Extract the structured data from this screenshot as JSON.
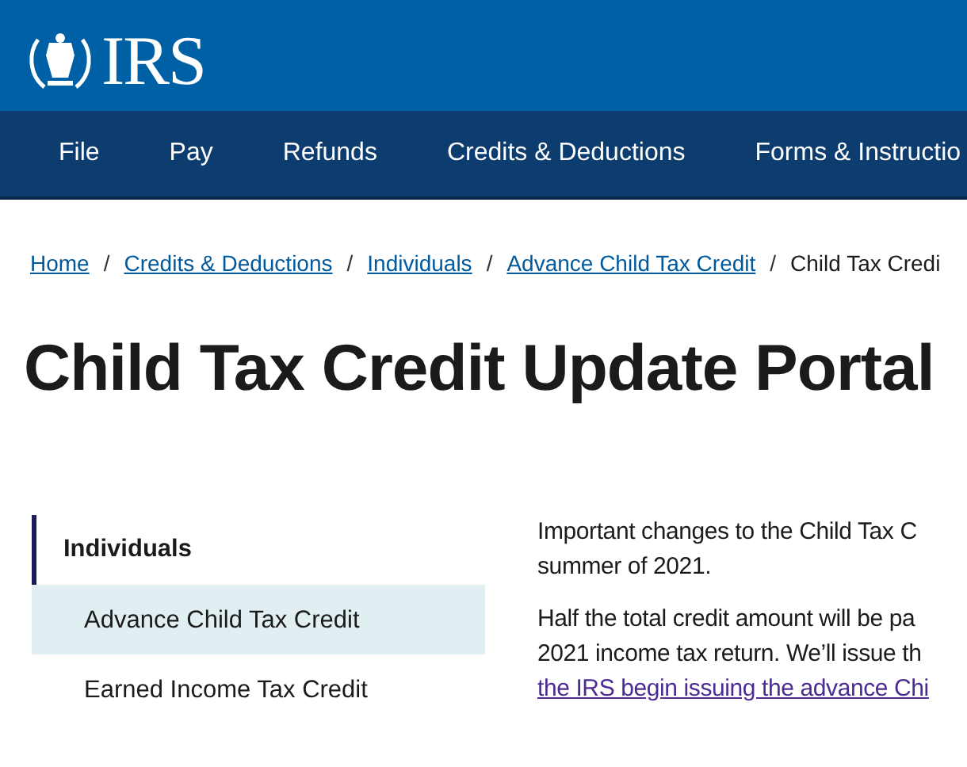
{
  "header": {
    "logo_text": "IRS"
  },
  "nav": [
    {
      "label": "File"
    },
    {
      "label": "Pay"
    },
    {
      "label": "Refunds"
    },
    {
      "label": "Credits & Deductions"
    },
    {
      "label": "Forms & Instructio"
    }
  ],
  "breadcrumb_separator": "/",
  "breadcrumb": [
    {
      "label": "Home",
      "kind": "link"
    },
    {
      "label": "Credits & Deductions",
      "kind": "link"
    },
    {
      "label": "Individuals",
      "kind": "link"
    },
    {
      "label": "Advance Child Tax Credit",
      "kind": "link"
    },
    {
      "label": "Child Tax Credi",
      "kind": "current"
    }
  ],
  "title": "Child Tax Credit Update Portal",
  "sidebar": {
    "heading": "Individuals",
    "items": [
      {
        "label": "Advance Child Tax Credit",
        "selected": true
      },
      {
        "label": "Earned Income Tax Credit",
        "selected": false
      }
    ]
  },
  "paragraphs": [
    {
      "lines": [
        {
          "text": "Important changes to the Child Tax C",
          "kind": "text"
        },
        {
          "text": "summer of 2021.",
          "kind": "text"
        }
      ]
    },
    {
      "lines": [
        {
          "text": "Half the total credit amount will be pa",
          "kind": "text"
        },
        {
          "text": "2021 income tax return. We’ll issue th",
          "kind": "text"
        },
        {
          "text": "the IRS begin issuing the advance Chi",
          "kind": "link"
        }
      ]
    }
  ]
}
